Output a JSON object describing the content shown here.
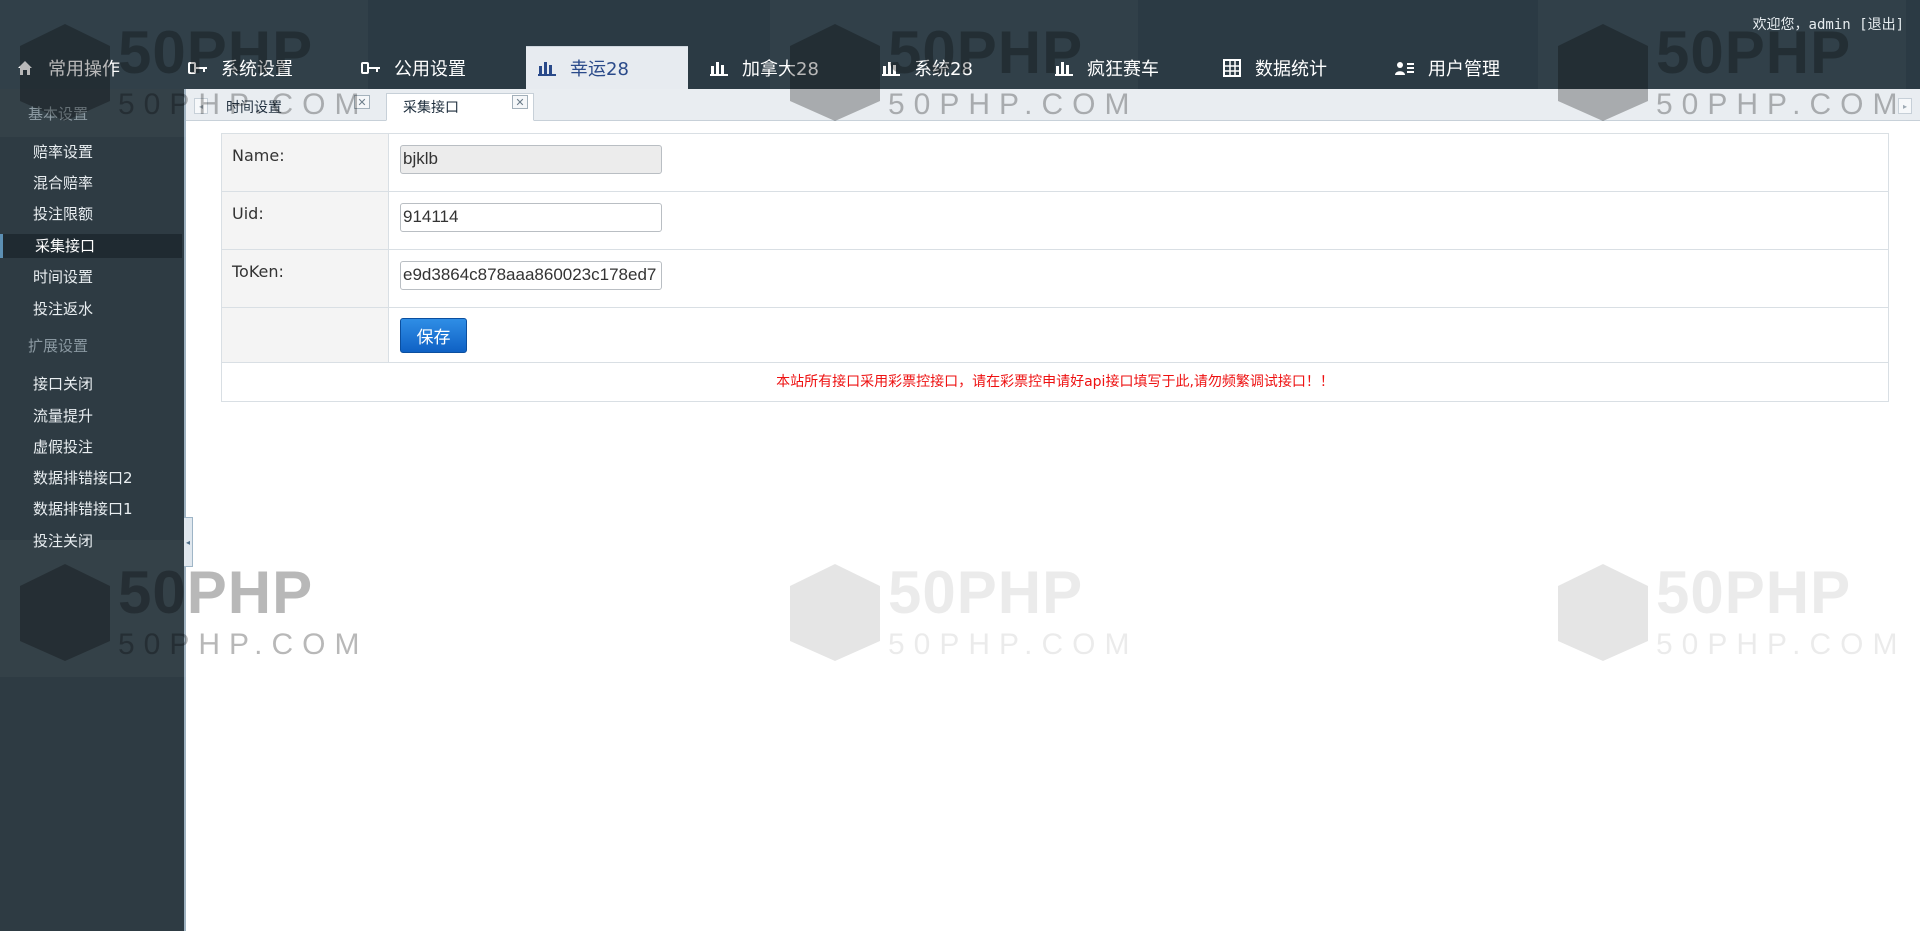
{
  "header": {
    "welcome_prefix": "欢迎您，admin ",
    "logout_label": "[退出]",
    "nav": [
      {
        "label": "常用操作",
        "icon": "home-icon"
      },
      {
        "label": "系统设置",
        "icon": "key-icon"
      },
      {
        "label": "公用设置",
        "icon": "key-icon"
      },
      {
        "label": "幸运28",
        "icon": "bar-chart-icon",
        "active": true
      },
      {
        "label": "加拿大28",
        "icon": "bar-chart-icon"
      },
      {
        "label": "系统28",
        "icon": "bar-chart-icon"
      },
      {
        "label": "疯狂赛车",
        "icon": "bar-chart-icon"
      },
      {
        "label": "数据统计",
        "icon": "grid-icon"
      },
      {
        "label": "用户管理",
        "icon": "user-list-icon"
      }
    ]
  },
  "sidebar": {
    "sections": [
      {
        "title": "基本设置",
        "items": [
          "赔率设置",
          "混合赔率",
          "投注限额",
          "采集接口",
          "时间设置",
          "投注返水"
        ]
      },
      {
        "title": "扩展设置",
        "items": [
          "接口关闭",
          "流量提升",
          "虚假投注",
          "数据排错接口2",
          "数据排错接口1",
          "投注关闭"
        ]
      }
    ],
    "active_item": "采集接口"
  },
  "tabs": [
    {
      "label": "时间设置",
      "active": false
    },
    {
      "label": "采集接口",
      "active": true
    }
  ],
  "form": {
    "fields": [
      {
        "label": "Name:",
        "value": "bjklb",
        "readonly": true
      },
      {
        "label": "Uid:",
        "value": "914114",
        "readonly": false
      },
      {
        "label": "ToKen:",
        "value": "e9d3864c878aaa860023c178ed7",
        "readonly": false
      }
    ],
    "save_label": "保存",
    "notice": "本站所有接口采用彩票控接口，请在彩票控申请好api接口填写于此,请勿频繁调试接口！！"
  },
  "watermark": {
    "big": "50PHP",
    "small": "50PHP.COM"
  },
  "colors": {
    "header_bg": "#2b3a44",
    "sidebar_bg": "#2e3b43",
    "active_tab_text": "#2a4a8a",
    "save_button": "#1574d4",
    "notice_text": "#ee1111"
  }
}
